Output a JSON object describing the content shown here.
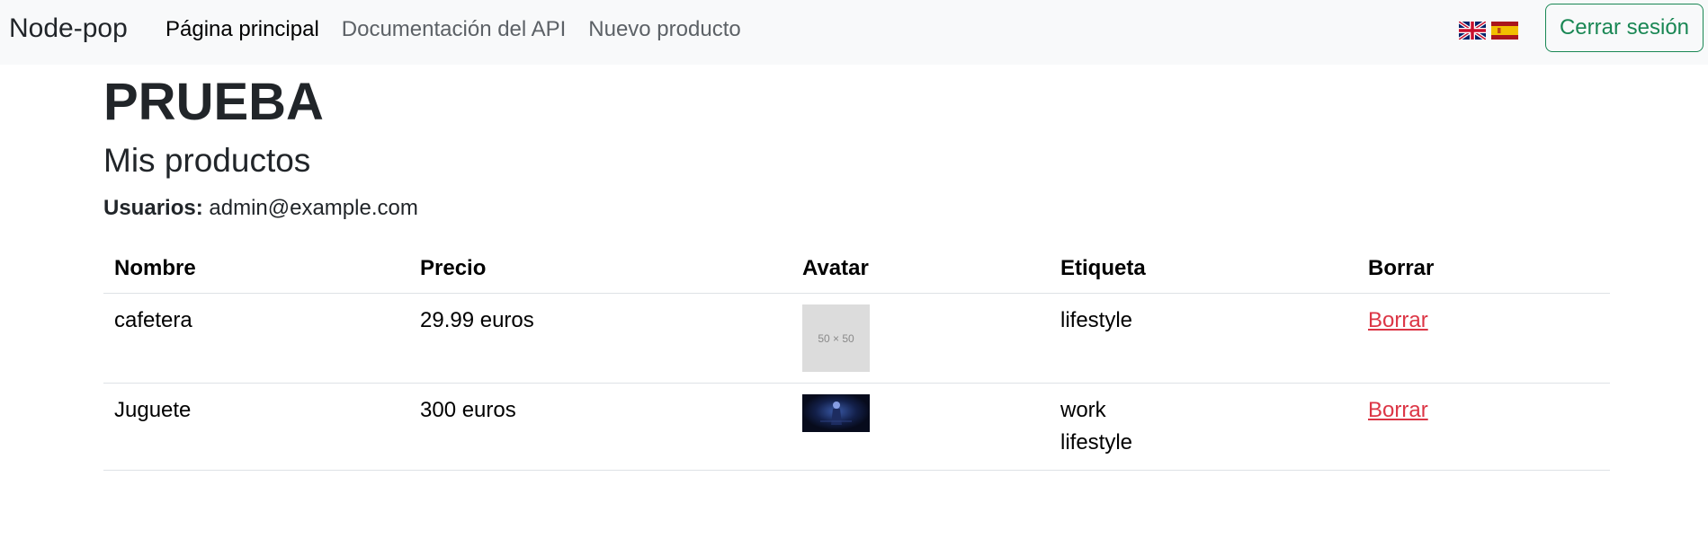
{
  "navbar": {
    "brand": "Node-pop",
    "links": [
      {
        "label": "Página principal",
        "active": true
      },
      {
        "label": "Documentación del API",
        "active": false
      },
      {
        "label": "Nuevo producto",
        "active": false
      }
    ],
    "flags": [
      {
        "icon": "uk-flag-icon",
        "language": "English"
      },
      {
        "icon": "spain-flag-icon",
        "language": "Español"
      }
    ],
    "logout_label": "Cerrar sesión"
  },
  "page": {
    "title": "PRUEBA",
    "section_title": "Mis productos",
    "users_label": "Usuarios:",
    "users_value": "admin@example.com"
  },
  "table": {
    "headers": [
      "Nombre",
      "Precio",
      "Avatar",
      "Etiqueta",
      "Borrar"
    ],
    "rows": [
      {
        "name": "cafetera",
        "price": "29.99 euros",
        "avatar_placeholder": "50 × 50",
        "tags": [
          "lifestyle"
        ],
        "delete_label": "Borrar"
      },
      {
        "name": "Juguete",
        "price": "300 euros",
        "avatar_placeholder": "",
        "tags": [
          "work",
          "lifestyle"
        ],
        "delete_label": "Borrar"
      }
    ]
  },
  "colors": {
    "navbar_bg": "#f8f9fa",
    "logout_accent": "#198754",
    "delete_link": "#dc3545",
    "placeholder_bg": "#dcdcdc"
  }
}
